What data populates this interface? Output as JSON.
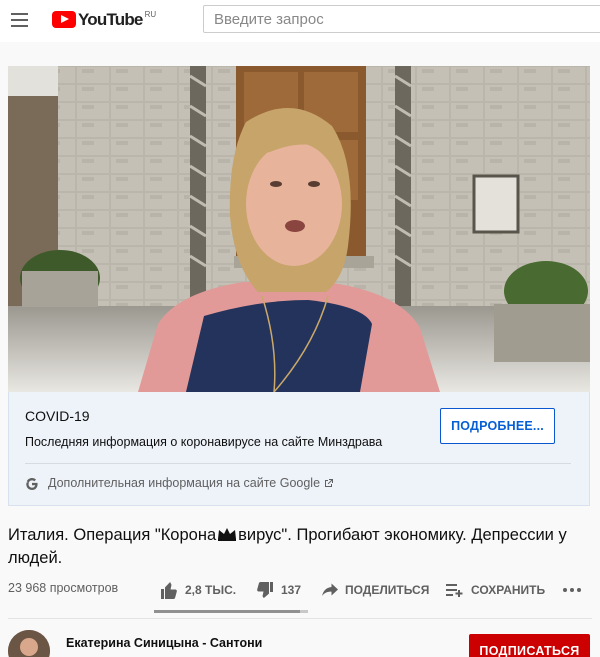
{
  "header": {
    "logo_text": "YouTube",
    "logo_region": "RU",
    "search_placeholder": "Введите запрос"
  },
  "info_panel": {
    "title": "COVID-19",
    "description": "Последняя информация о коронавирусе на сайте Минздрава",
    "button_label": "ПОДРОБНЕЕ...",
    "more_link": "Дополнительная информация на сайте Google"
  },
  "video": {
    "title_part1": "Италия. Операция \"Корона",
    "title_part2": "вирус\". Прогибают экономику. Депрессии у людей.",
    "views": "23 968 просмотров",
    "likes": "2,8 ТЫС.",
    "dislikes": "137",
    "share_label": "ПОДЕЛИТЬСЯ",
    "save_label": "СОХРАНИТЬ",
    "like_ratio": 0.95
  },
  "channel": {
    "name": "Екатерина Синицына - Сантони",
    "subscribe_label": "ПОДПИСАТЬСЯ"
  },
  "colors": {
    "brand_red": "#ff0000",
    "subscribe_red": "#cc0000",
    "link_blue": "#065fd4",
    "panel_bg": "#eef3fa"
  },
  "icons": [
    "menu-icon",
    "youtube-logo-icon",
    "google-g-icon",
    "external-link-icon",
    "thumb-up-icon",
    "thumb-down-icon",
    "share-icon",
    "save-to-playlist-icon",
    "more-icon"
  ]
}
